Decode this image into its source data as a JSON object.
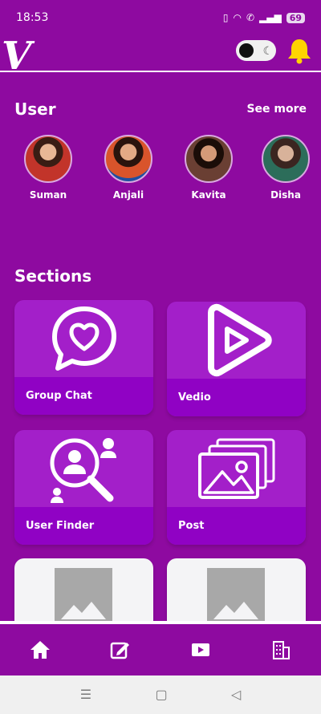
{
  "status": {
    "time": "18:53",
    "battery": "69"
  },
  "header": {
    "logo": "V"
  },
  "users_section": {
    "title": "User",
    "see_more": "See more",
    "users": [
      {
        "name": "Suman"
      },
      {
        "name": "Anjali"
      },
      {
        "name": "Kavita"
      },
      {
        "name": "Disha"
      }
    ]
  },
  "sections": {
    "title": "Sections",
    "cards": [
      {
        "label": "Group Chat",
        "icon": "chat-heart-icon"
      },
      {
        "label": "Vedio",
        "icon": "play-icon"
      },
      {
        "label": "User Finder",
        "icon": "user-search-icon"
      },
      {
        "label": "Post",
        "icon": "images-icon"
      }
    ]
  },
  "bottom_nav": [
    "home-icon",
    "edit-icon",
    "video-icon",
    "building-icon"
  ],
  "colors": {
    "background": "#8e0aa0",
    "card": "#a31fc9",
    "card_footer": "#9002c4",
    "bell": "#ffd400"
  }
}
